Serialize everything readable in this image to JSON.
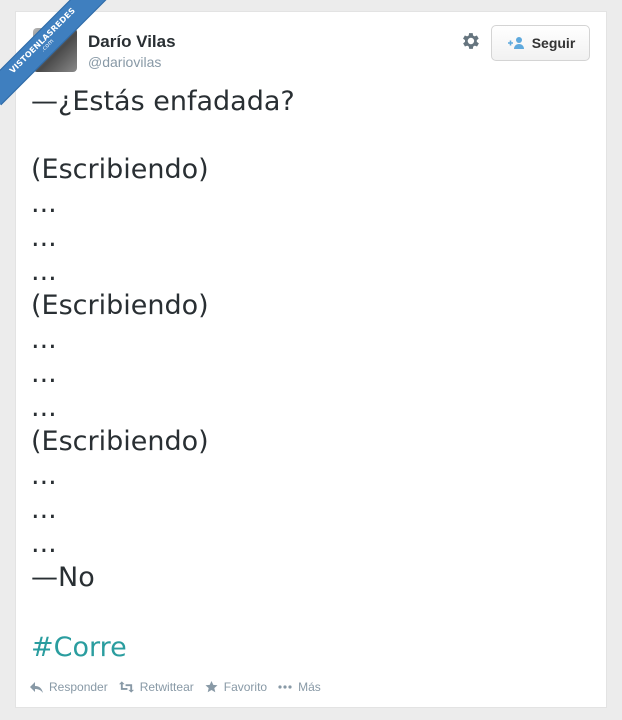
{
  "watermark": {
    "text": "VISTOENLASREDES",
    "suffix": ".com"
  },
  "user": {
    "name": "Darío Vilas",
    "handle": "@dariovilas"
  },
  "header": {
    "follow_label": "Seguir"
  },
  "tweet": {
    "text": "—¿Estás enfadada?\n\n(Escribiendo)\n...\n...\n...\n(Escribiendo)\n...\n...\n...\n(Escribiendo)\n...\n...\n...\n—No",
    "hashtag": "#Corre"
  },
  "actions": {
    "reply": "Responder",
    "retweet": "Retwittear",
    "favorite": "Favorito",
    "more": "Más"
  },
  "colors": {
    "hashtag": "#2a9d9f",
    "meta": "#8899a6",
    "ribbon": "#3f7fbf"
  }
}
